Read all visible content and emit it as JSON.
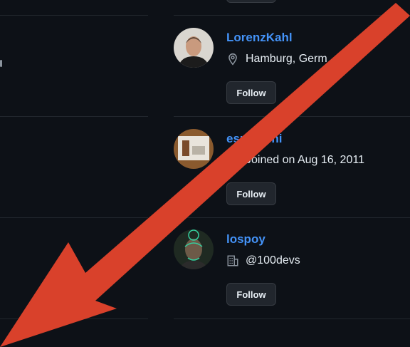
{
  "colors": {
    "background": "#0d1117",
    "username": "#4493f8",
    "text": "#e6edf3",
    "muted": "#8b949e",
    "button_bg": "#21262d",
    "annotation_arrow": "#d9412b"
  },
  "users": [
    {
      "username": "LorenzKahl",
      "meta_icon": "location-icon",
      "meta_text": "Hamburg, Germ",
      "follow_label": "Follow"
    },
    {
      "username": "esmuschi",
      "meta_icon": "clock-icon",
      "meta_text": "Joined on Aug 16, 2011",
      "follow_label": "Follow"
    },
    {
      "username": "lospoy",
      "meta_icon": "organization-icon",
      "meta_text": "@100devs",
      "follow_label": "Follow"
    }
  ]
}
